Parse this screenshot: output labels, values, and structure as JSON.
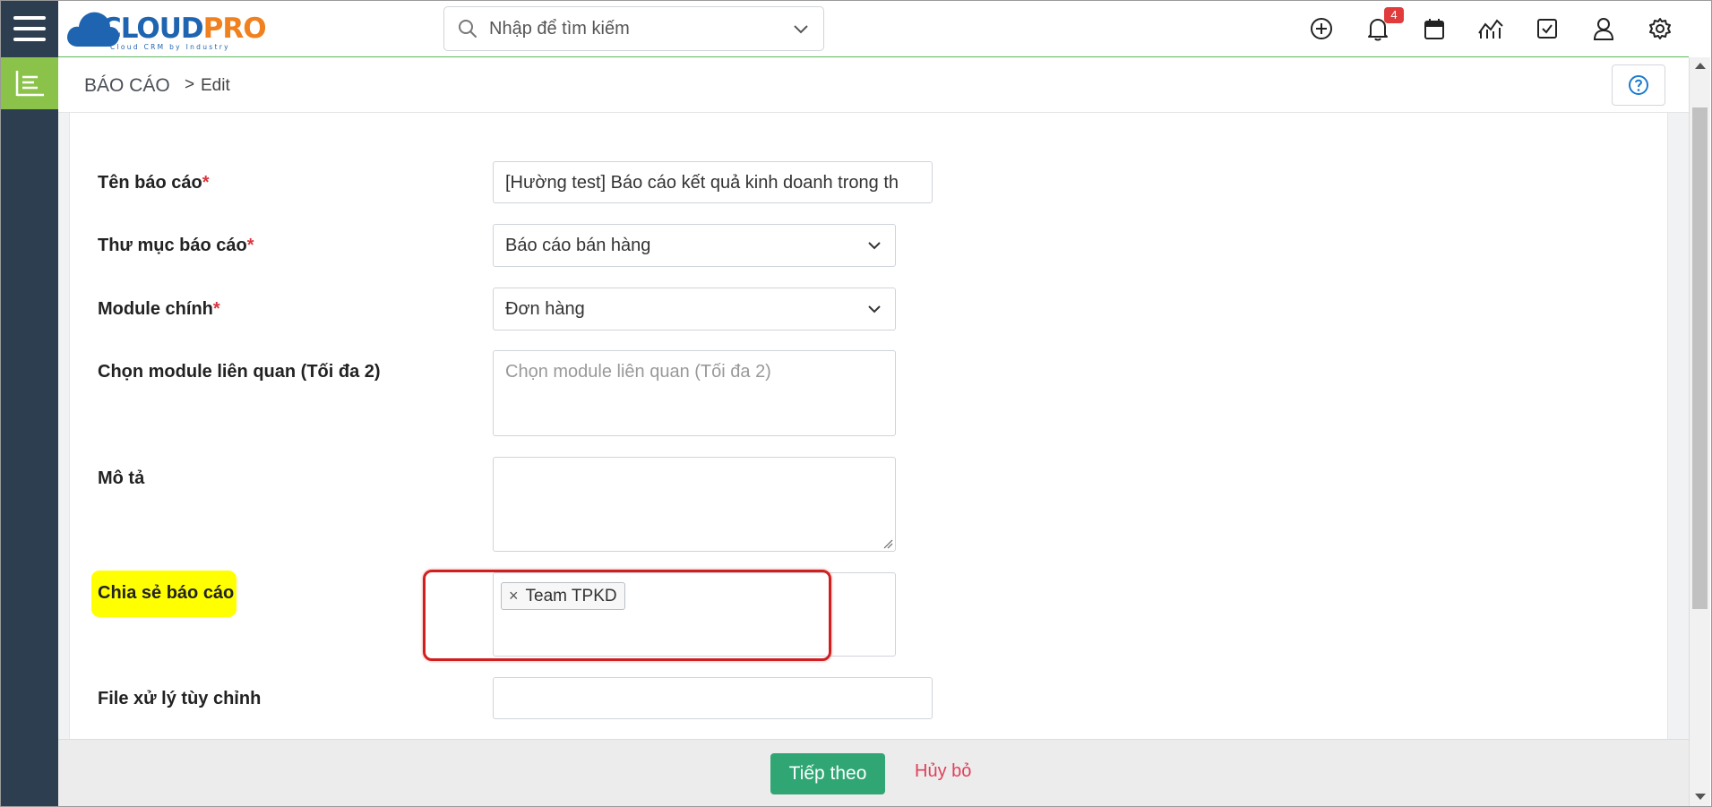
{
  "header": {
    "logo_text": "CLOUDPRO",
    "logo_tagline": "Cloud CRM by Industry",
    "search_placeholder": "Nhập để tìm kiếm",
    "notification_count": "4",
    "icons": [
      "hamburger-icon",
      "search-icon",
      "chevron-down-icon",
      "plus-circle-icon",
      "bell-icon",
      "calendar-icon",
      "report-chart-icon",
      "task-check-icon",
      "user-icon",
      "gear-icon"
    ]
  },
  "breadcrumb": {
    "title": "BÁO CÁO",
    "separator": ">",
    "current": "Edit"
  },
  "form": {
    "report_name": {
      "label": "Tên báo cáo",
      "required": "*",
      "value": "[Hường test] Báo cáo kết quả kinh doanh trong th"
    },
    "report_folder": {
      "label": "Thư mục báo cáo",
      "required": "*",
      "value": "Báo cáo bán hàng"
    },
    "main_module": {
      "label": "Module chính",
      "required": "*",
      "value": "Đơn hàng"
    },
    "related_modules": {
      "label": "Chọn module liên quan (Tối đa 2)",
      "placeholder": "Chọn module liên quan (Tối đa 2)"
    },
    "description": {
      "label": "Mô tả",
      "value": ""
    },
    "share_report": {
      "label": "Chia sẻ báo cáo",
      "chips": [
        "Team TPKD"
      ],
      "chip_remove": "×"
    },
    "custom_file": {
      "label": "File xử lý tùy chỉnh",
      "value": ""
    }
  },
  "footer": {
    "next_label": "Tiếp theo",
    "cancel_label": "Hủy bỏ"
  },
  "colors": {
    "sidebar": "#2c3e50",
    "active_rail": "#8bc34a",
    "primary_button": "#2fa673",
    "cancel_text": "#e0405a",
    "highlight": "#ffff00",
    "annotation_box": "#d11f1f",
    "badge": "#e03c3c"
  }
}
